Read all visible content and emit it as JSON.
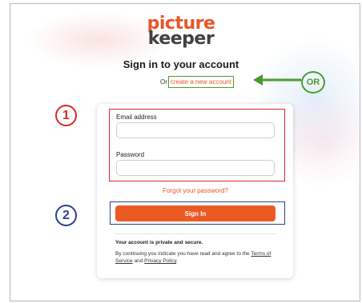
{
  "logo": {
    "line1": "picture",
    "line2": "keeper"
  },
  "heading": {
    "title": "Sign in to your account",
    "or_text": "Or",
    "create_link": "create a new account"
  },
  "form": {
    "email_label": "Email address",
    "email_value": "",
    "password_label": "Password",
    "password_value": "",
    "forgot_link": "Forgot your password?",
    "signin_label": "Sign In"
  },
  "footer": {
    "private_text": "Your account is private and secure.",
    "terms_prefix": "By continuing you indicate you have read and agree to the",
    "terms_link": "Terms of Service",
    "terms_and": "and",
    "privacy_link": "Privacy Policy",
    "terms_suffix": "."
  },
  "annotations": {
    "badge_1": "1",
    "badge_2": "2",
    "badge_or": "OR",
    "colors": {
      "red": "#d42a2a",
      "blue": "#29428b",
      "green": "#4b9b2e",
      "accent": "#ec5a24"
    }
  }
}
